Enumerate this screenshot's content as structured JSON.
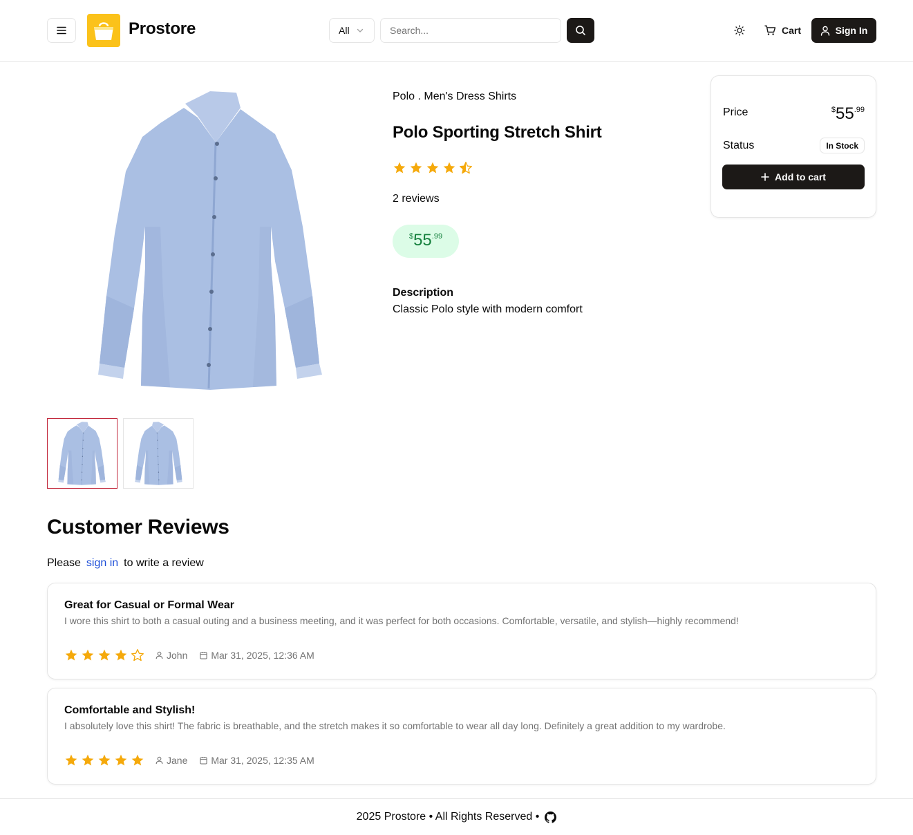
{
  "header": {
    "brand": "Prostore",
    "category_select": "All",
    "search_placeholder": "Search...",
    "cart_label": "Cart",
    "sign_in_label": "Sign In"
  },
  "product": {
    "brand_category": "Polo . Men's Dress Shirts",
    "name": "Polo Sporting Stretch Shirt",
    "rating": 4.5,
    "reviews_count_text": "2 reviews",
    "price": {
      "currency": "$",
      "whole": "55",
      "cents": ".99"
    },
    "description_title": "Description",
    "description": "Classic Polo style with modern comfort",
    "thumbnails": [
      "shirt-front",
      "shirt-back"
    ],
    "selected_thumbnail": 0
  },
  "price_card": {
    "price_label": "Price",
    "price": {
      "currency": "$",
      "whole": "55",
      "cents": ".99"
    },
    "status_label": "Status",
    "status_value": "In Stock",
    "add_to_cart_label": "Add to cart"
  },
  "reviews": {
    "title": "Customer Reviews",
    "prompt_before": "Please",
    "prompt_link": "sign in",
    "prompt_after": "to write a review",
    "items": [
      {
        "title": "Great for Casual or Formal Wear",
        "body": "I wore this shirt to both a casual outing and a business meeting, and it was perfect for both occasions. Comfortable, versatile, and stylish—highly recommend!",
        "rating": 4,
        "author": "John",
        "date": "Mar 31, 2025, 12:36 AM"
      },
      {
        "title": "Comfortable and Stylish!",
        "body": "I absolutely love this shirt! The fabric is breathable, and the stretch makes it so comfortable to wear all day long. Definitely a great addition to my wardrobe.",
        "rating": 5,
        "author": "Jane",
        "date": "Mar 31, 2025, 12:35 AM"
      }
    ]
  },
  "footer": {
    "text": "2025 Prostore • All Rights Reserved •"
  },
  "colors": {
    "accent_dark": "#1c1917",
    "logo_yellow": "#fbc21a",
    "star": "#f5a90b",
    "price_bg": "#dcfce7",
    "price_text": "#15803d",
    "link": "#1d4ed8",
    "active_thumb_border": "#c2283b"
  },
  "icons": [
    "menu-icon",
    "shopping-bag-logo",
    "chevron-down-icon",
    "search-icon",
    "sun-icon",
    "cart-icon",
    "user-icon",
    "plus-icon",
    "star-icon",
    "calendar-icon",
    "github-icon"
  ]
}
